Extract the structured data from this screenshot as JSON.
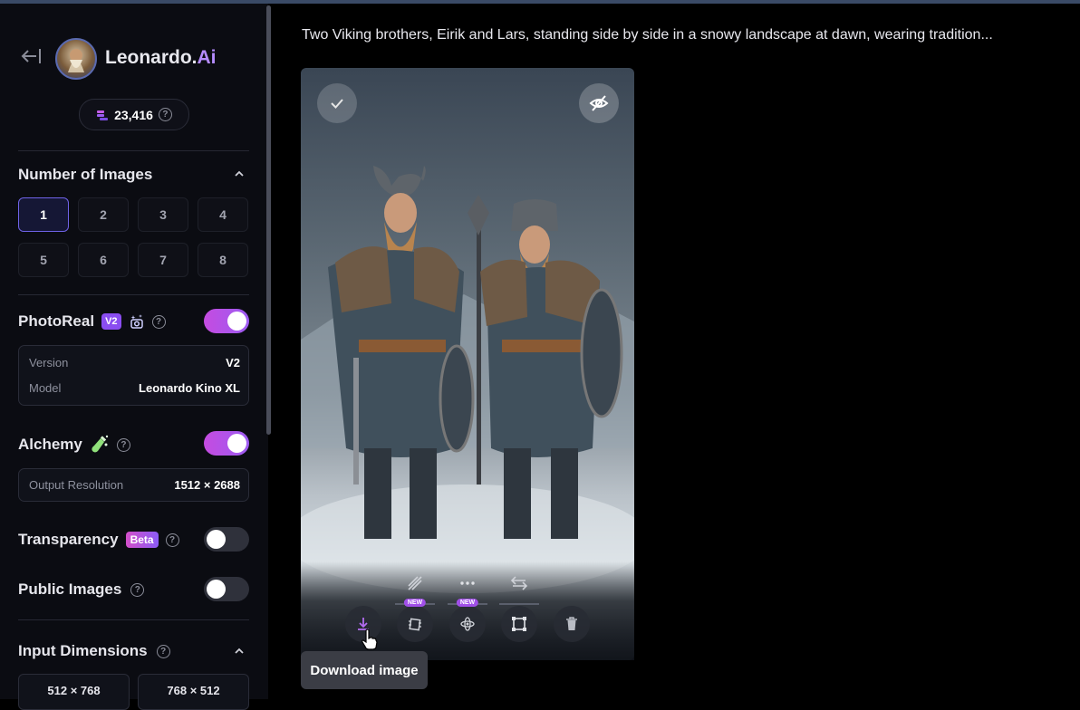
{
  "app": {
    "logo_main": "Leonardo.",
    "logo_accent": "Ai",
    "credits": "23,416"
  },
  "number_of_images": {
    "title": "Number of Images",
    "options": [
      "1",
      "2",
      "3",
      "4",
      "5",
      "6",
      "7",
      "8"
    ],
    "selected": "1"
  },
  "photoreal": {
    "title": "PhotoReal",
    "badge": "V2",
    "enabled": true,
    "version_label": "Version",
    "version_value": "V2",
    "model_label": "Model",
    "model_value": "Leonardo Kino XL"
  },
  "alchemy": {
    "title": "Alchemy",
    "enabled": true,
    "resolution_label": "Output Resolution",
    "resolution_value": "1512 × 2688"
  },
  "transparency": {
    "title": "Transparency",
    "badge": "Beta",
    "enabled": false
  },
  "public_images": {
    "title": "Public Images",
    "enabled": false
  },
  "input_dimensions": {
    "title": "Input Dimensions",
    "options": [
      "512 × 768",
      "768 × 512"
    ]
  },
  "generation": {
    "prompt": "Two Viking brothers, Eirik and Lars, standing side by side in a snowy landscape at dawn, wearing tradition...",
    "tools_top": [
      "remove-background-icon",
      "more-options-icon",
      "swap-icon"
    ],
    "tools_bottom": [
      "download-icon",
      "motion-icon",
      "3d-icon",
      "crop-icon",
      "delete-icon"
    ],
    "new_badge": "NEW",
    "tooltip": "Download image"
  },
  "colors": {
    "accent": "#9d5cf2",
    "selected_border": "#6f63e8",
    "toggle_on": "#c54be0"
  }
}
